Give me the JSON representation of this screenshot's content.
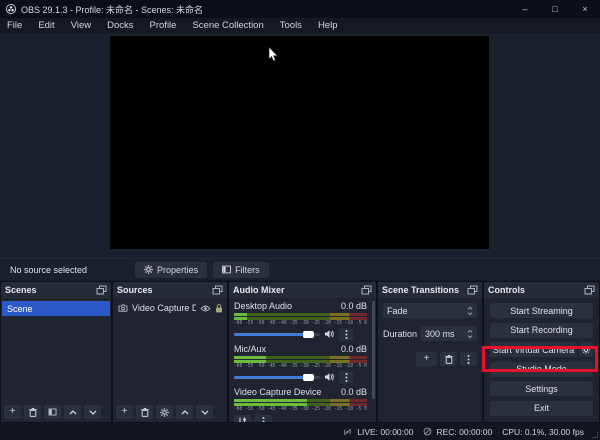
{
  "window": {
    "title": "OBS 29.1.3 - Profile: 未命名 - Scenes: 未命名",
    "controls": {
      "minimize": "–",
      "maximize": "□",
      "close": "×"
    }
  },
  "menu": {
    "items": [
      "File",
      "Edit",
      "View",
      "Docks",
      "Profile",
      "Scene Collection",
      "Tools",
      "Help"
    ]
  },
  "preview": {
    "status_text": "No source selected",
    "properties_label": "Properties",
    "filters_label": "Filters"
  },
  "scenes": {
    "title": "Scenes",
    "items": [
      {
        "label": "Scene",
        "selected": true
      }
    ]
  },
  "sources": {
    "title": "Sources",
    "items": [
      {
        "label": "Video Capture D"
      }
    ]
  },
  "mixer": {
    "title": "Audio Mixer",
    "ticks_text": "-60 -55 -50 -45 -40 -35 -30 -25 -20 -15 -10 -5 0",
    "channels": [
      {
        "name": "Desktop Audio",
        "level": "0.0 dB",
        "signal_pct": 10,
        "slider_pct": 88
      },
      {
        "name": "Mic/Aux",
        "level": "0.0 dB",
        "signal_pct": 24,
        "slider_pct": 88
      },
      {
        "name": "Video Capture Device",
        "level": "0.0 dB",
        "signal_pct": 55
      }
    ]
  },
  "transitions": {
    "title": "Scene Transitions",
    "selected": "Fade",
    "duration_label": "Duration",
    "duration_value": "300 ms"
  },
  "controls_panel": {
    "title": "Controls",
    "buttons": [
      "Start Streaming",
      "Start Recording",
      "Start Virtual Camera",
      "Studio Mode",
      "Settings",
      "Exit"
    ],
    "highlighted": "Start Virtual Camera"
  },
  "statusbar": {
    "live": "LIVE: 00:00:00",
    "rec": "REC: 00:00:00",
    "cpu": "CPU: 0.1%, 30.00 fps"
  },
  "colors": {
    "selection_blue": "#2b57c7",
    "slider_blue": "#3f7edb",
    "annotation_red": "#e8112d",
    "meter_green": "#6cbb3c",
    "meter_yellow": "#797121",
    "meter_red": "#74262f"
  }
}
